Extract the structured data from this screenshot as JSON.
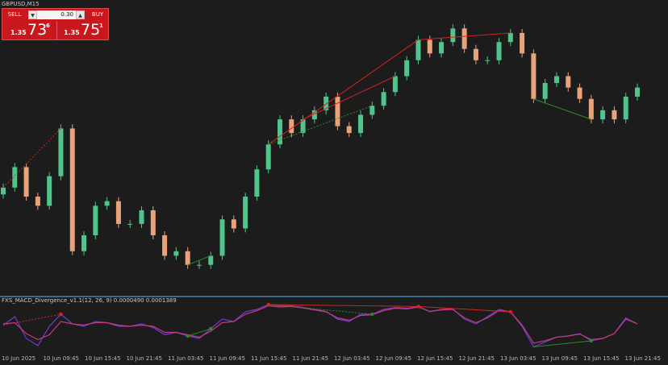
{
  "symbol": {
    "title": "GBPUSD,M15"
  },
  "trade_panel": {
    "sell_label": "SELL",
    "buy_label": "BUY",
    "lot_size": "0.30",
    "bid": {
      "prefix": "1.35",
      "big": "73",
      "sup": "6"
    },
    "ask": {
      "prefix": "1.35",
      "big": "75",
      "sup": "1"
    }
  },
  "indicator": {
    "title": "FXS_MACD_Divergence_v1.1(12, 26, 9) 0.0000490 0.0001389"
  },
  "colors": {
    "bull": "#4fc48b",
    "bear": "#e8a37a",
    "bear_line": "#d62222",
    "bull_line": "#2c8c2c",
    "macd": "#6d3bd6",
    "signal": "#c43b7a"
  },
  "time_axis": [
    "10 Jun 2025",
    "10 Jun 09:45",
    "10 Jun 15:45",
    "10 Jun 21:45",
    "11 Jun 03:45",
    "11 Jun 09:45",
    "11 Jun 15:45",
    "11 Jun 21:45",
    "12 Jun 03:45",
    "12 Jun 09:45",
    "12 Jun 15:45",
    "12 Jun 21:45",
    "13 Jun 03:45",
    "13 Jun 09:45",
    "13 Jun 15:45",
    "13 Jun 21:45"
  ],
  "chart_data": {
    "type": "candlestick",
    "series": [
      {
        "name": "GBPUSD,M15",
        "close": [
          0.66,
          0.75,
          0.62,
          0.58,
          0.71,
          0.92,
          0.38,
          0.45,
          0.58,
          0.6,
          0.5,
          0.5,
          0.56,
          0.45,
          0.36,
          0.38,
          0.32,
          0.32,
          0.36,
          0.52,
          0.48,
          0.62,
          0.74,
          0.85,
          0.96,
          0.9,
          0.96,
          1.0,
          1.06,
          0.93,
          0.9,
          0.98,
          1.02,
          1.08,
          1.15,
          1.22,
          1.31,
          1.25,
          1.3,
          1.36,
          1.27,
          1.22,
          1.22,
          1.3,
          1.34,
          1.25,
          1.05,
          1.12,
          1.15,
          1.1,
          1.05,
          0.96,
          1.0,
          0.96,
          1.06,
          1.1
        ]
      }
    ],
    "indicator_series": [
      {
        "name": "macd",
        "values": [
          0.05,
          0.4,
          -0.5,
          -0.8,
          0.0,
          0.5,
          0.1,
          0.0,
          0.2,
          0.15,
          0.0,
          0.0,
          0.1,
          -0.05,
          -0.35,
          -0.25,
          -0.4,
          -0.5,
          -0.1,
          0.3,
          0.2,
          0.6,
          0.7,
          0.9,
          0.85,
          0.85,
          0.78,
          0.7,
          0.62,
          0.3,
          0.2,
          0.5,
          0.5,
          0.7,
          0.78,
          0.75,
          0.82,
          0.6,
          0.7,
          0.72,
          0.3,
          0.1,
          0.4,
          0.7,
          0.6,
          0.0,
          -0.85,
          -0.65,
          -0.45,
          -0.4,
          -0.3,
          -0.6,
          -0.5,
          -0.3,
          0.35,
          0.1
        ]
      },
      {
        "name": "signal",
        "values": [
          0.1,
          0.15,
          -0.3,
          -0.55,
          -0.35,
          0.2,
          0.1,
          0.05,
          0.15,
          0.15,
          0.05,
          0.0,
          0.05,
          0.0,
          -0.25,
          -0.25,
          -0.35,
          -0.45,
          -0.2,
          0.15,
          0.2,
          0.5,
          0.65,
          0.85,
          0.8,
          0.82,
          0.76,
          0.68,
          0.6,
          0.35,
          0.25,
          0.45,
          0.48,
          0.65,
          0.75,
          0.72,
          0.8,
          0.62,
          0.68,
          0.7,
          0.35,
          0.15,
          0.35,
          0.65,
          0.6,
          0.05,
          -0.7,
          -0.6,
          -0.45,
          -0.4,
          -0.32,
          -0.55,
          -0.5,
          -0.3,
          0.3,
          0.1
        ]
      }
    ]
  }
}
